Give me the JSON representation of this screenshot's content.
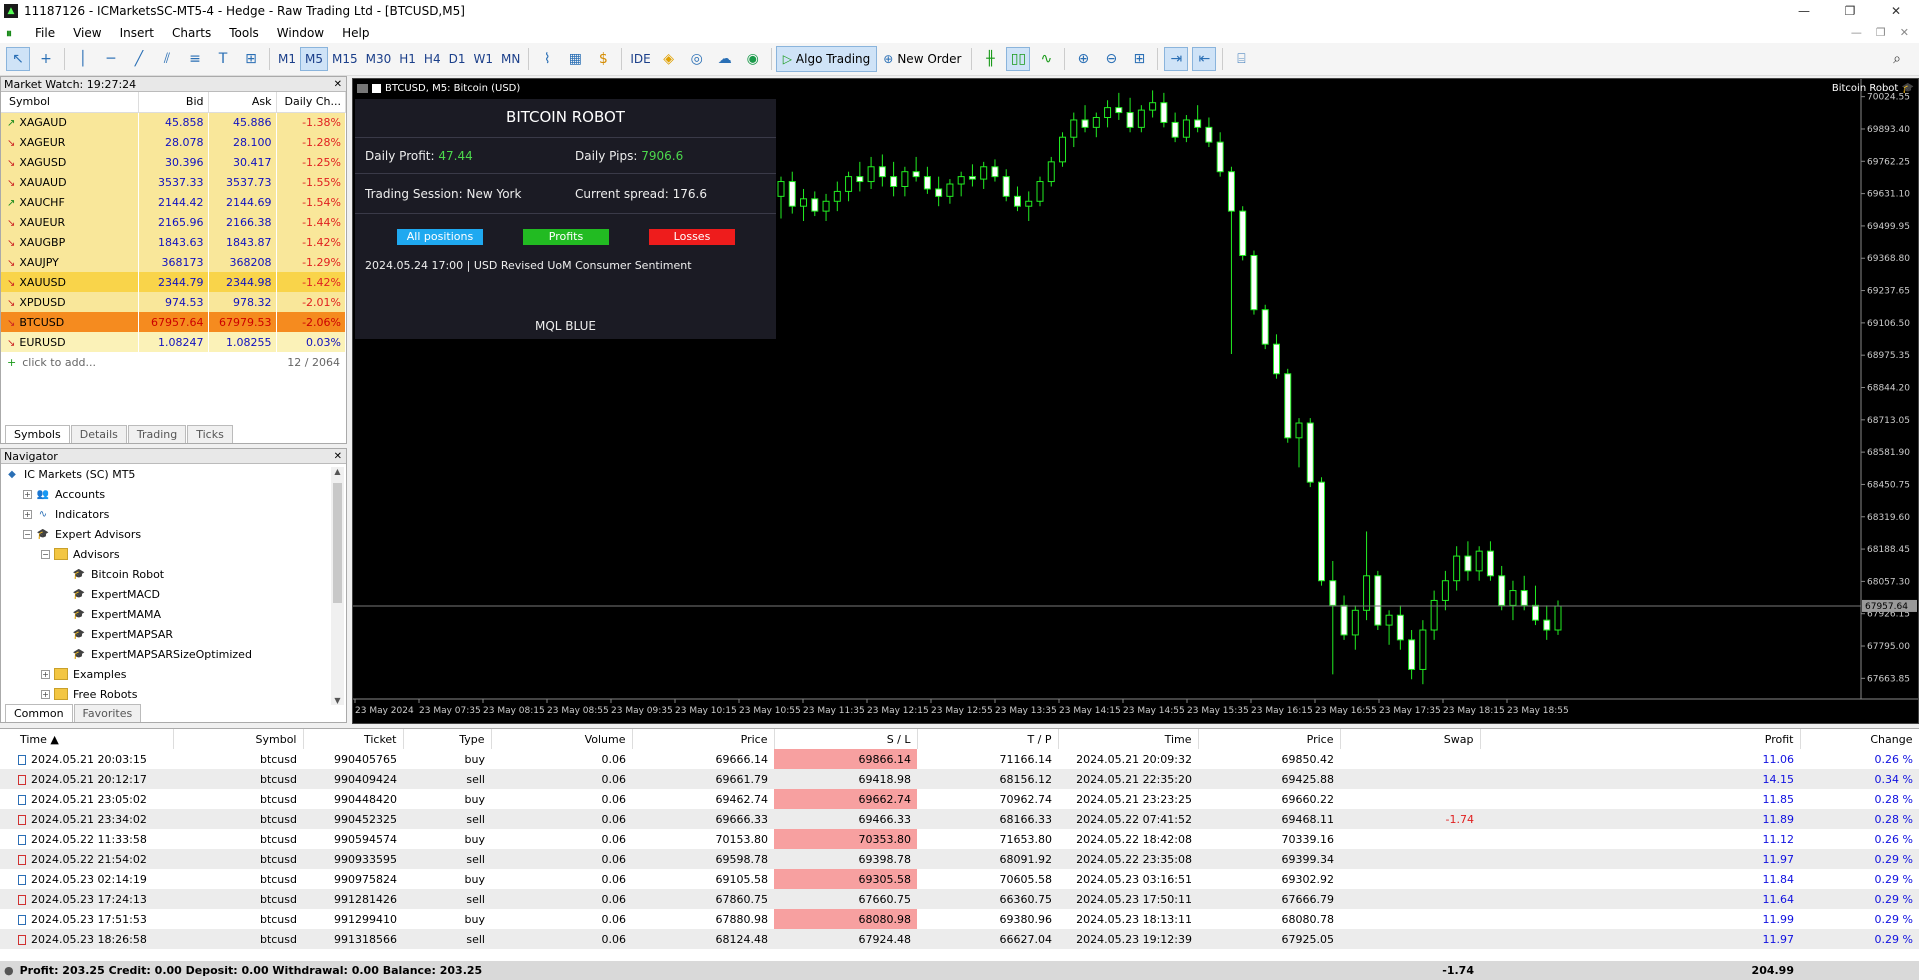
{
  "window": {
    "title": "11187126 - ICMarketsSC-MT5-4 - Hedge - Raw Trading Ltd - [BTCUSD,M5]",
    "controls": [
      "—",
      "❐",
      "✕"
    ]
  },
  "menu": [
    "File",
    "View",
    "Insert",
    "Charts",
    "Tools",
    "Window",
    "Help"
  ],
  "toolbar": {
    "timeframes": [
      "M1",
      "M5",
      "M15",
      "M30",
      "H1",
      "H4",
      "D1",
      "W1",
      "MN"
    ],
    "active_timeframe": "M5",
    "ide_label": "IDE",
    "algo_label": "Algo Trading",
    "new_order_label": "New Order"
  },
  "market_watch": {
    "header": "Market Watch: 19:27:24",
    "columns": [
      "Symbol",
      "Bid",
      "Ask",
      "Daily Ch..."
    ],
    "rows": [
      {
        "symbol": "XAGAUD",
        "bid": "45.858",
        "ask": "45.886",
        "chg": "-1.38%",
        "dir": "up",
        "style": "yellow"
      },
      {
        "symbol": "XAGEUR",
        "bid": "28.078",
        "ask": "28.100",
        "chg": "-1.28%",
        "dir": "dn",
        "style": "yellow"
      },
      {
        "symbol": "XAGUSD",
        "bid": "30.396",
        "ask": "30.417",
        "chg": "-1.25%",
        "dir": "dn",
        "style": "yellow"
      },
      {
        "symbol": "XAUAUD",
        "bid": "3537.33",
        "ask": "3537.73",
        "chg": "-1.55%",
        "dir": "dn",
        "style": "yellow"
      },
      {
        "symbol": "XAUCHF",
        "bid": "2144.42",
        "ask": "2144.69",
        "chg": "-1.54%",
        "dir": "up",
        "style": "yellow"
      },
      {
        "symbol": "XAUEUR",
        "bid": "2165.96",
        "ask": "2166.38",
        "chg": "-1.44%",
        "dir": "dn",
        "style": "yellow"
      },
      {
        "symbol": "XAUGBP",
        "bid": "1843.63",
        "ask": "1843.87",
        "chg": "-1.42%",
        "dir": "dn",
        "style": "yellow"
      },
      {
        "symbol": "XAUJPY",
        "bid": "368173",
        "ask": "368208",
        "chg": "-1.29%",
        "dir": "dn",
        "style": "yellow"
      },
      {
        "symbol": "XAUUSD",
        "bid": "2344.79",
        "ask": "2344.98",
        "chg": "-1.42%",
        "dir": "dn",
        "style": "gold"
      },
      {
        "symbol": "XPDUSD",
        "bid": "974.53",
        "ask": "978.32",
        "chg": "-2.01%",
        "dir": "dn",
        "style": "yellow"
      },
      {
        "symbol": "BTCUSD",
        "bid": "67957.64",
        "ask": "67979.53",
        "chg": "-2.06%",
        "dir": "dn",
        "style": "orange"
      },
      {
        "symbol": "EURUSD",
        "bid": "1.08247",
        "ask": "1.08255",
        "chg": "0.03%",
        "dir": "dn",
        "style": "lyellow"
      }
    ],
    "add_label": "click to add...",
    "count": "12 / 2064",
    "tabs": [
      "Symbols",
      "Details",
      "Trading",
      "Ticks"
    ]
  },
  "navigator": {
    "header": "Navigator",
    "items": [
      {
        "label": "IC Markets (SC) MT5",
        "level": 0,
        "exp": "",
        "icon": "broker"
      },
      {
        "label": "Accounts",
        "level": 1,
        "exp": "+",
        "icon": "accounts"
      },
      {
        "label": "Indicators",
        "level": 1,
        "exp": "+",
        "icon": "indicators"
      },
      {
        "label": "Expert Advisors",
        "level": 1,
        "exp": "−",
        "icon": "cap"
      },
      {
        "label": "Advisors",
        "level": 2,
        "exp": "−",
        "icon": "folder"
      },
      {
        "label": "Bitcoin Robot",
        "level": 3,
        "exp": "",
        "icon": "cap"
      },
      {
        "label": "ExpertMACD",
        "level": 3,
        "exp": "",
        "icon": "cap"
      },
      {
        "label": "ExpertMAMA",
        "level": 3,
        "exp": "",
        "icon": "cap"
      },
      {
        "label": "ExpertMAPSAR",
        "level": 3,
        "exp": "",
        "icon": "cap"
      },
      {
        "label": "ExpertMAPSARSizeOptimized",
        "level": 3,
        "exp": "",
        "icon": "cap"
      },
      {
        "label": "Examples",
        "level": 2,
        "exp": "+",
        "icon": "folder"
      },
      {
        "label": "Free Robots",
        "level": 2,
        "exp": "+",
        "icon": "folder"
      }
    ],
    "tabs": [
      "Common",
      "Favorites"
    ]
  },
  "chart": {
    "title": "BTCUSD, M5:  Bitcoin (USD)",
    "robot_label": "Bitcoin Robot",
    "current_price": "67957.64",
    "price_labels": [
      "70024.55",
      "69893.40",
      "69762.25",
      "69631.10",
      "69499.95",
      "69368.80",
      "69237.65",
      "69106.50",
      "68975.35",
      "68844.20",
      "68713.05",
      "68581.90",
      "68450.75",
      "68319.60",
      "68188.45",
      "68057.30",
      "67926.15",
      "67795.00",
      "67663.85"
    ],
    "time_labels": [
      "23 May 2024",
      "23 May 07:35",
      "23 May 08:15",
      "23 May 08:55",
      "23 May 09:35",
      "23 May 10:15",
      "23 May 10:55",
      "23 May 11:35",
      "23 May 12:15",
      "23 May 12:55",
      "23 May 13:35",
      "23 May 14:15",
      "23 May 14:55",
      "23 May 15:35",
      "23 May 16:15",
      "23 May 16:55",
      "23 May 17:35",
      "23 May 18:15",
      "23 May 18:55"
    ],
    "ylim": [
      67580,
      70080
    ],
    "candles": [
      {
        "o": 69620,
        "h": 69700,
        "l": 69530,
        "c": 69680
      },
      {
        "o": 69680,
        "h": 69720,
        "l": 69550,
        "c": 69580
      },
      {
        "o": 69580,
        "h": 69650,
        "l": 69520,
        "c": 69610
      },
      {
        "o": 69610,
        "h": 69640,
        "l": 69540,
        "c": 69560
      },
      {
        "o": 69560,
        "h": 69630,
        "l": 69520,
        "c": 69600
      },
      {
        "o": 69600,
        "h": 69680,
        "l": 69560,
        "c": 69640
      },
      {
        "o": 69640,
        "h": 69720,
        "l": 69600,
        "c": 69700
      },
      {
        "o": 69700,
        "h": 69760,
        "l": 69640,
        "c": 69680
      },
      {
        "o": 69680,
        "h": 69780,
        "l": 69650,
        "c": 69740
      },
      {
        "o": 69740,
        "h": 69790,
        "l": 69660,
        "c": 69700
      },
      {
        "o": 69700,
        "h": 69760,
        "l": 69620,
        "c": 69660
      },
      {
        "o": 69660,
        "h": 69740,
        "l": 69620,
        "c": 69720
      },
      {
        "o": 69720,
        "h": 69780,
        "l": 69680,
        "c": 69700
      },
      {
        "o": 69700,
        "h": 69740,
        "l": 69630,
        "c": 69650
      },
      {
        "o": 69650,
        "h": 69700,
        "l": 69580,
        "c": 69620
      },
      {
        "o": 69620,
        "h": 69690,
        "l": 69590,
        "c": 69670
      },
      {
        "o": 69670,
        "h": 69720,
        "l": 69620,
        "c": 69700
      },
      {
        "o": 69700,
        "h": 69750,
        "l": 69660,
        "c": 69690
      },
      {
        "o": 69690,
        "h": 69760,
        "l": 69650,
        "c": 69740
      },
      {
        "o": 69740,
        "h": 69770,
        "l": 69680,
        "c": 69700
      },
      {
        "o": 69700,
        "h": 69730,
        "l": 69600,
        "c": 69620
      },
      {
        "o": 69620,
        "h": 69660,
        "l": 69560,
        "c": 69580
      },
      {
        "o": 69580,
        "h": 69640,
        "l": 69520,
        "c": 69600
      },
      {
        "o": 69600,
        "h": 69700,
        "l": 69580,
        "c": 69680
      },
      {
        "o": 69680,
        "h": 69780,
        "l": 69660,
        "c": 69760
      },
      {
        "o": 69760,
        "h": 69880,
        "l": 69740,
        "c": 69860
      },
      {
        "o": 69860,
        "h": 69960,
        "l": 69820,
        "c": 69930
      },
      {
        "o": 69930,
        "h": 69990,
        "l": 69880,
        "c": 69900
      },
      {
        "o": 69900,
        "h": 69960,
        "l": 69860,
        "c": 69940
      },
      {
        "o": 69940,
        "h": 70010,
        "l": 69900,
        "c": 69980
      },
      {
        "o": 69980,
        "h": 70040,
        "l": 69930,
        "c": 69960
      },
      {
        "o": 69960,
        "h": 70020,
        "l": 69880,
        "c": 69900
      },
      {
        "o": 69900,
        "h": 69990,
        "l": 69880,
        "c": 69970
      },
      {
        "o": 69970,
        "h": 70050,
        "l": 69940,
        "c": 70000
      },
      {
        "o": 70000,
        "h": 70040,
        "l": 69900,
        "c": 69920
      },
      {
        "o": 69920,
        "h": 69960,
        "l": 69840,
        "c": 69860
      },
      {
        "o": 69860,
        "h": 69950,
        "l": 69840,
        "c": 69930
      },
      {
        "o": 69930,
        "h": 69990,
        "l": 69880,
        "c": 69900
      },
      {
        "o": 69900,
        "h": 69940,
        "l": 69820,
        "c": 69840
      },
      {
        "o": 69840,
        "h": 69880,
        "l": 69700,
        "c": 69720
      },
      {
        "o": 69720,
        "h": 69740,
        "l": 68980,
        "c": 69560
      },
      {
        "o": 69560,
        "h": 69580,
        "l": 69360,
        "c": 69380
      },
      {
        "o": 69380,
        "h": 69400,
        "l": 69140,
        "c": 69160
      },
      {
        "o": 69160,
        "h": 69180,
        "l": 69000,
        "c": 69020
      },
      {
        "o": 69020,
        "h": 69060,
        "l": 68880,
        "c": 68900
      },
      {
        "o": 68900,
        "h": 68920,
        "l": 68620,
        "c": 68640
      },
      {
        "o": 68640,
        "h": 68720,
        "l": 68520,
        "c": 68700
      },
      {
        "o": 68700,
        "h": 68720,
        "l": 68440,
        "c": 68460
      },
      {
        "o": 68460,
        "h": 68480,
        "l": 68040,
        "c": 68060
      },
      {
        "o": 68060,
        "h": 68140,
        "l": 67680,
        "c": 67960
      },
      {
        "o": 67960,
        "h": 68000,
        "l": 67820,
        "c": 67840
      },
      {
        "o": 67840,
        "h": 67960,
        "l": 67780,
        "c": 67940
      },
      {
        "o": 67940,
        "h": 68260,
        "l": 67900,
        "c": 68080
      },
      {
        "o": 68080,
        "h": 68100,
        "l": 67860,
        "c": 67880
      },
      {
        "o": 67880,
        "h": 67940,
        "l": 67800,
        "c": 67920
      },
      {
        "o": 67920,
        "h": 67960,
        "l": 67780,
        "c": 67820
      },
      {
        "o": 67820,
        "h": 67860,
        "l": 67660,
        "c": 67700
      },
      {
        "o": 67700,
        "h": 67900,
        "l": 67640,
        "c": 67860
      },
      {
        "o": 67860,
        "h": 68020,
        "l": 67820,
        "c": 67980
      },
      {
        "o": 67980,
        "h": 68100,
        "l": 67940,
        "c": 68060
      },
      {
        "o": 68060,
        "h": 68200,
        "l": 68020,
        "c": 68160
      },
      {
        "o": 68160,
        "h": 68220,
        "l": 68060,
        "c": 68100
      },
      {
        "o": 68100,
        "h": 68200,
        "l": 68060,
        "c": 68180
      },
      {
        "o": 68180,
        "h": 68220,
        "l": 68060,
        "c": 68080
      },
      {
        "o": 68080,
        "h": 68120,
        "l": 67940,
        "c": 67960
      },
      {
        "o": 67960,
        "h": 68060,
        "l": 67900,
        "c": 68020
      },
      {
        "o": 68020,
        "h": 68080,
        "l": 67940,
        "c": 67960
      },
      {
        "o": 67960,
        "h": 68040,
        "l": 67880,
        "c": 67900
      },
      {
        "o": 67900,
        "h": 67960,
        "l": 67820,
        "c": 67860
      },
      {
        "o": 67860,
        "h": 67980,
        "l": 67840,
        "c": 67957
      }
    ]
  },
  "robot_panel": {
    "title": "BITCOIN ROBOT",
    "daily_profit_label": "Daily Profit:",
    "daily_profit": "47.44",
    "daily_pips_label": "Daily Pips:",
    "daily_pips": "7906.6",
    "session_label": "Trading Session: New York",
    "spread_label": "Current spread: 176.6",
    "btn_all": "All positions",
    "btn_profits": "Profits",
    "btn_losses": "Losses",
    "news": "2024.05.24 17:00  |  USD    Revised UoM Consumer Sentiment",
    "brand": "MQL BLUE",
    "colors": {
      "all": "#1fa9f0",
      "profits": "#22bb22",
      "losses": "#ee1c1c",
      "value": "#4cd84c"
    }
  },
  "history": {
    "columns": [
      "Time ▲",
      "Symbol",
      "Ticket",
      "Type",
      "Volume",
      "Price",
      "S / L",
      "T / P",
      "Time",
      "Price",
      "Swap",
      "Profit",
      "Change"
    ],
    "rows": [
      [
        "2024.05.21 20:03:15",
        "btcusd",
        "990405765",
        "buy",
        "0.06",
        "69666.14",
        "69866.14",
        "71166.14",
        "2024.05.21 20:09:32",
        "69850.42",
        "",
        "11.06",
        "0.26 %"
      ],
      [
        "2024.05.21 20:12:17",
        "btcusd",
        "990409424",
        "sell",
        "0.06",
        "69661.79",
        "69418.98",
        "68156.12",
        "2024.05.21 22:35:20",
        "69425.88",
        "",
        "14.15",
        "0.34 %"
      ],
      [
        "2024.05.21 23:05:02",
        "btcusd",
        "990448420",
        "buy",
        "0.06",
        "69462.74",
        "69662.74",
        "70962.74",
        "2024.05.21 23:23:25",
        "69660.22",
        "",
        "11.85",
        "0.28 %"
      ],
      [
        "2024.05.21 23:34:02",
        "btcusd",
        "990452325",
        "sell",
        "0.06",
        "69666.33",
        "69466.33",
        "68166.33",
        "2024.05.22 07:41:52",
        "69468.11",
        "-1.74",
        "11.89",
        "0.28 %"
      ],
      [
        "2024.05.22 11:33:58",
        "btcusd",
        "990594574",
        "buy",
        "0.06",
        "70153.80",
        "70353.80",
        "71653.80",
        "2024.05.22 18:42:08",
        "70339.16",
        "",
        "11.12",
        "0.26 %"
      ],
      [
        "2024.05.22 21:54:02",
        "btcusd",
        "990933595",
        "sell",
        "0.06",
        "69598.78",
        "69398.78",
        "68091.92",
        "2024.05.22 23:35:08",
        "69399.34",
        "",
        "11.97",
        "0.29 %"
      ],
      [
        "2024.05.23 02:14:19",
        "btcusd",
        "990975824",
        "buy",
        "0.06",
        "69105.58",
        "69305.58",
        "70605.58",
        "2024.05.23 03:16:51",
        "69302.92",
        "",
        "11.84",
        "0.29 %"
      ],
      [
        "2024.05.23 17:24:13",
        "btcusd",
        "991281426",
        "sell",
        "0.06",
        "67860.75",
        "67660.75",
        "66360.75",
        "2024.05.23 17:50:11",
        "67666.79",
        "",
        "11.64",
        "0.29 %"
      ],
      [
        "2024.05.23 17:51:53",
        "btcusd",
        "991299410",
        "buy",
        "0.06",
        "67880.98",
        "68080.98",
        "69380.96",
        "2024.05.23 18:13:11",
        "68080.78",
        "",
        "11.99",
        "0.29 %"
      ],
      [
        "2024.05.23 18:26:58",
        "btcusd",
        "991318566",
        "sell",
        "0.06",
        "68124.48",
        "67924.48",
        "66627.04",
        "2024.05.23 19:12:39",
        "67925.05",
        "",
        "11.97",
        "0.29 %"
      ]
    ],
    "summary": "Profit: 203.25  Credit: 0.00  Deposit: 0.00  Withdrawal: 0.00  Balance: 203.25",
    "total_swap": "-1.74",
    "total_profit": "204.99"
  }
}
